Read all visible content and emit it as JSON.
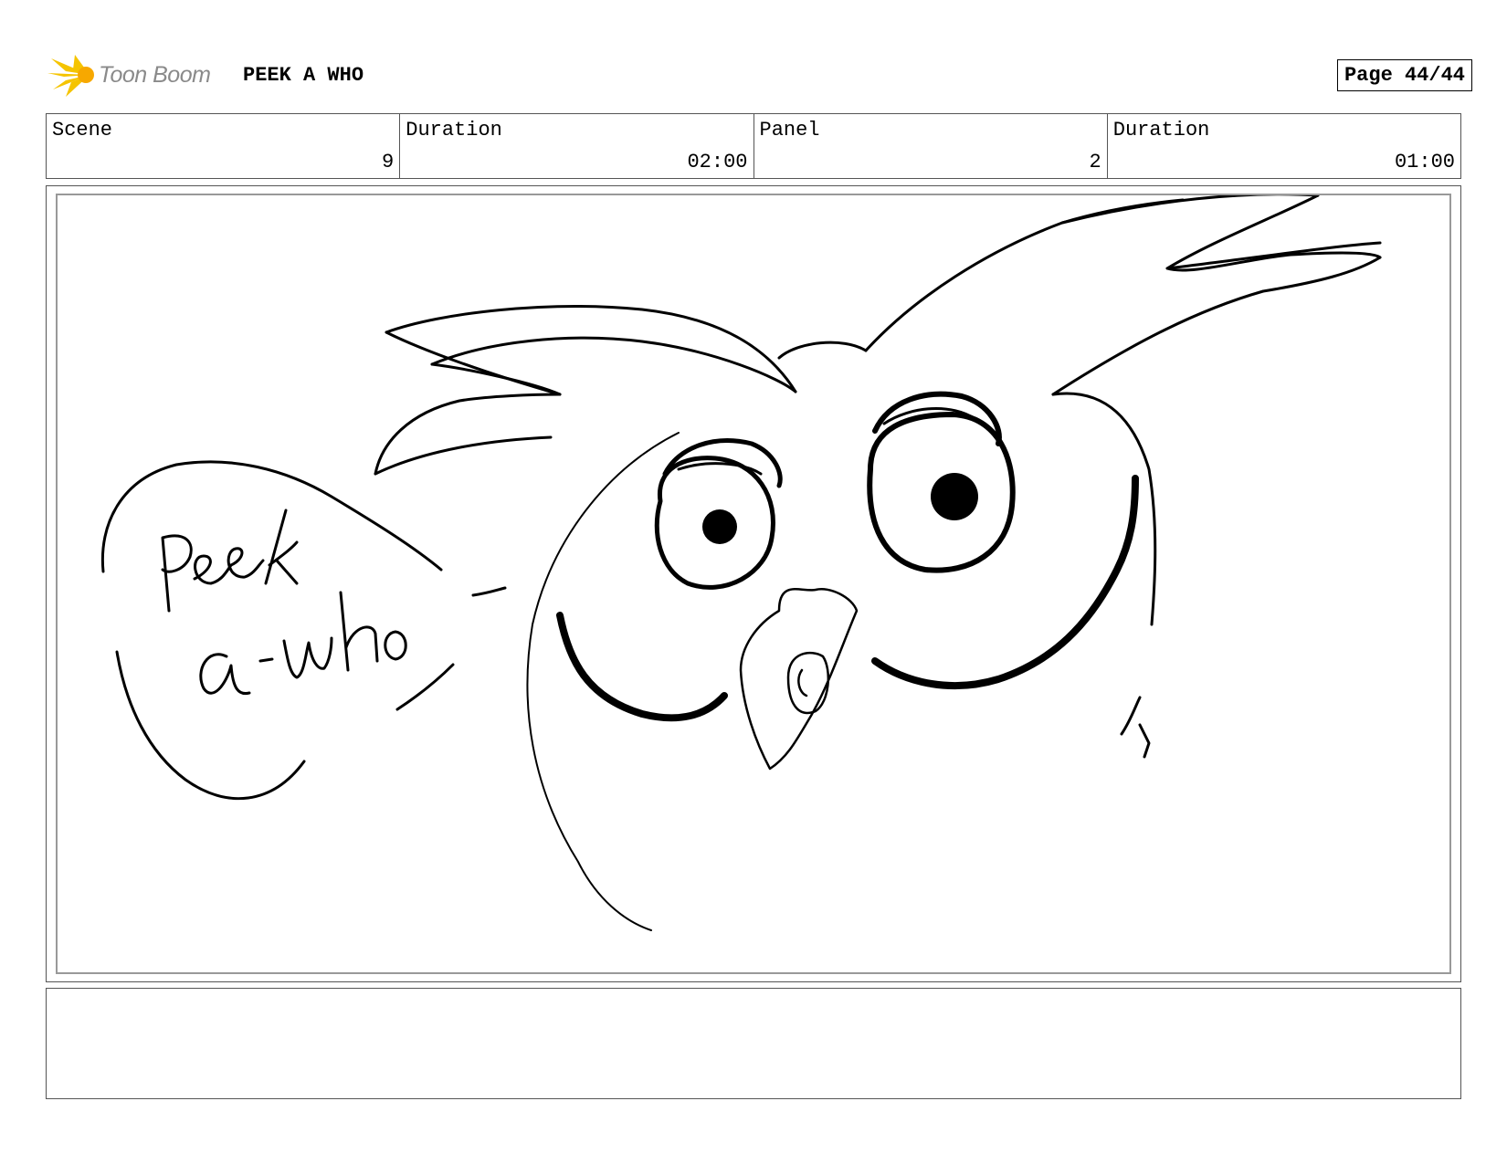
{
  "header": {
    "logo_text": "Toon Boom",
    "project_title": "PEEK A WHO",
    "page_label": "Page 44/44"
  },
  "info": [
    {
      "label": "Scene",
      "value": "9"
    },
    {
      "label": "Duration",
      "value": "02:00"
    },
    {
      "label": "Panel",
      "value": "2"
    },
    {
      "label": "Duration",
      "value": "01:00"
    }
  ],
  "panel": {
    "speech_text": "Peek a-who",
    "icon": "owl-sketch"
  },
  "notes": {
    "text": ""
  },
  "colors": {
    "logo_accent": "#f5c400",
    "logo_text": "#8a8a8a"
  }
}
